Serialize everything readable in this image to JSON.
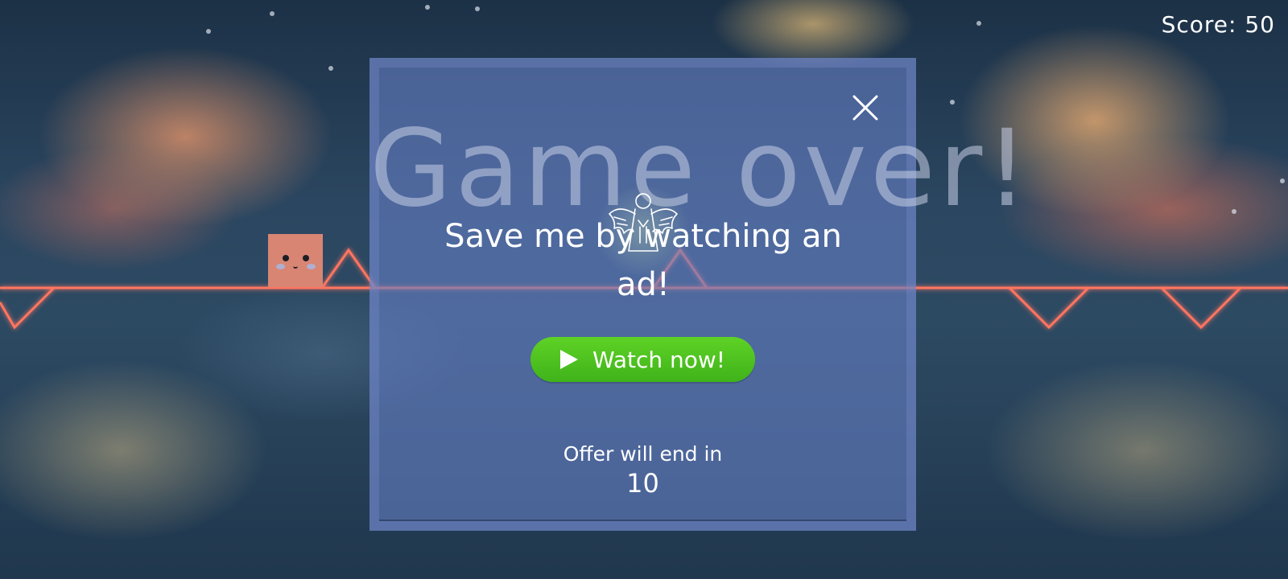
{
  "hud": {
    "score_text": "Score: 50"
  },
  "modal": {
    "title": "Game over!",
    "message": "Save me by watching an ad!",
    "watch_button_label": "Watch now!",
    "offer_text": "Offer will end in",
    "countdown": "10"
  },
  "colors": {
    "laser": "#ff6a55",
    "player": "#d98574",
    "watch_button": "#4cc220",
    "modal_overlay": "#647ec4"
  },
  "icons": {
    "close": "close-icon",
    "play": "play-icon",
    "angel": "angel-icon"
  }
}
